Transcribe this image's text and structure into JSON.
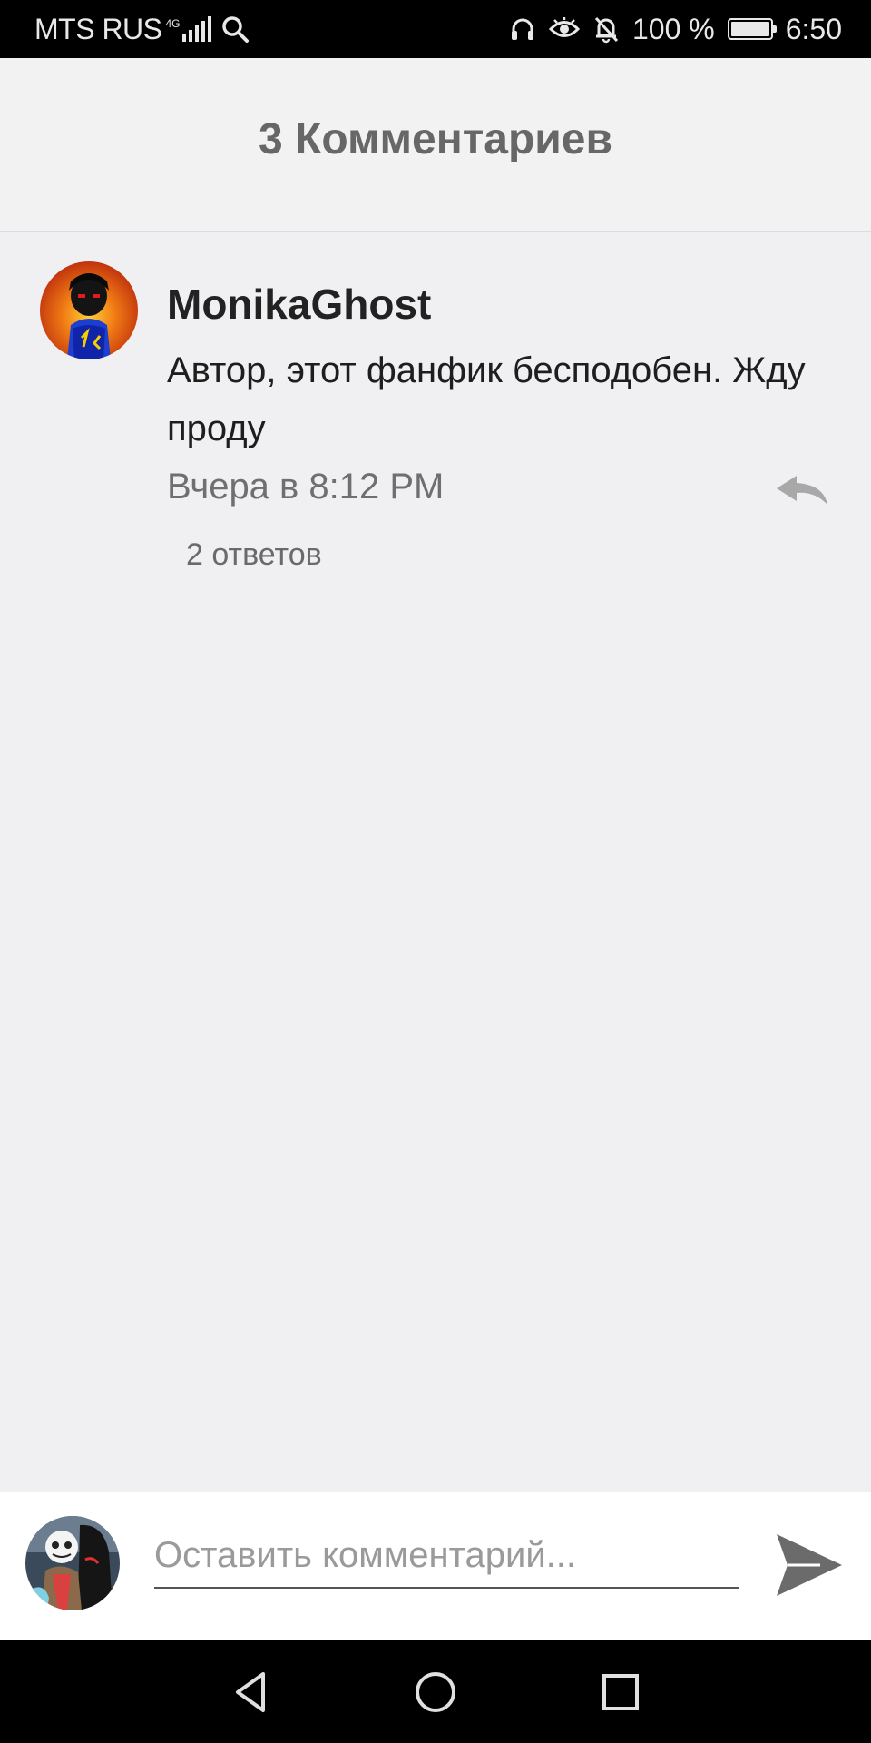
{
  "status_bar": {
    "carrier": "MTS RUS",
    "network_type": "4G",
    "battery_percent": "100 %",
    "battery_level": 1.0,
    "time": "6:50",
    "icons": [
      "signal-icon",
      "search-icon",
      "headphones-icon",
      "eye-icon",
      "bell-off-icon",
      "battery-icon"
    ]
  },
  "header": {
    "title": "3 Комментариев"
  },
  "comment": {
    "author": "MonikaGhost",
    "text": "Автор, этот фанфик бесподобен. Жду проду",
    "time": "Вчера в 8:12 PM",
    "replies": "2 ответов",
    "reply_icon": "reply-icon"
  },
  "composer": {
    "placeholder": "Оставить комментарий...",
    "value": "",
    "send_icon": "send-icon"
  },
  "nav_bar": {
    "icons": [
      "back-icon",
      "home-icon",
      "recents-icon"
    ]
  },
  "colors": {
    "background": "#f0eff2",
    "header_bg": "#f2f2f2",
    "title": "#676767",
    "author": "#222222",
    "meta": "#6f6f6f",
    "icon_gray": "#a8a8a8"
  }
}
